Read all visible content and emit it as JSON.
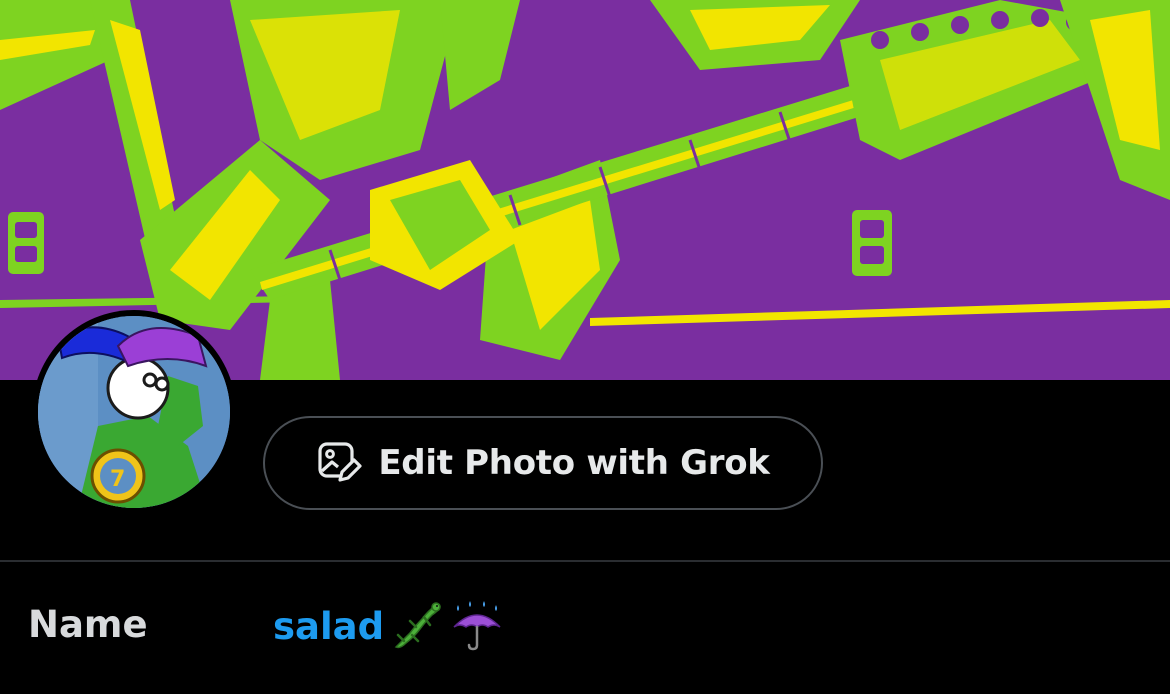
{
  "header_photo": {
    "description_icon": "header-photo",
    "colors": {
      "purple": "#7a2ea0",
      "green": "#7ed321",
      "yellow": "#f2e500"
    }
  },
  "profile_photo": {
    "icon": "avatar-cartoon"
  },
  "edit_photo_button": {
    "icon": "image-edit-icon",
    "label": "Edit Photo with Grok"
  },
  "fields": {
    "name": {
      "label": "Name",
      "value": "salad",
      "emojis": [
        "lizard-emoji",
        "umbrella-with-rain-emoji"
      ]
    }
  },
  "colors": {
    "background": "#000000",
    "accent": "#1d9bf0",
    "button_border": "#4a4f55",
    "divider": "#2a2d31"
  }
}
